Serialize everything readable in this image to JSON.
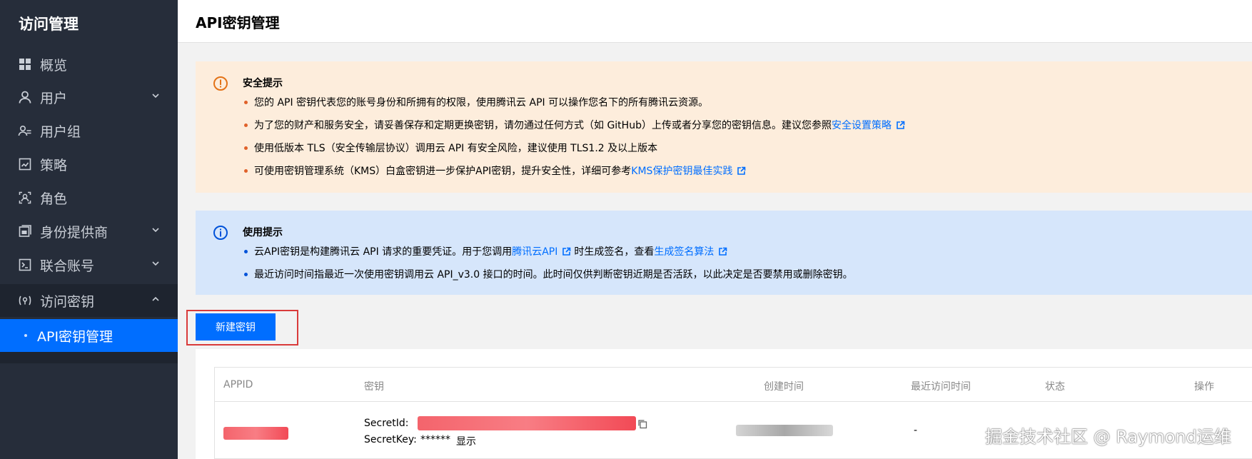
{
  "sidebar": {
    "title": "访问管理",
    "items": [
      {
        "label": "概览",
        "icon": "grid-icon"
      },
      {
        "label": "用户",
        "icon": "user-icon",
        "expandable": true
      },
      {
        "label": "用户组",
        "icon": "user-group-icon"
      },
      {
        "label": "策略",
        "icon": "policy-icon"
      },
      {
        "label": "角色",
        "icon": "role-icon"
      },
      {
        "label": "身份提供商",
        "icon": "identity-provider-icon",
        "expandable": true
      },
      {
        "label": "联合账号",
        "icon": "federated-account-icon",
        "expandable": true
      },
      {
        "label": "访问密钥",
        "icon": "access-key-icon",
        "expandable": true,
        "expanded": true
      }
    ],
    "sub_item": {
      "label": "API密钥管理",
      "active": true
    }
  },
  "header": {
    "title": "API密钥管理"
  },
  "security_notice": {
    "title": "安全提示",
    "lines": [
      "您的 API 密钥代表您的账号身份和所拥有的权限，使用腾讯云 API 可以操作您名下的所有腾讯云资源。",
      "为了您的财产和服务安全，请妥善保存和定期更换密钥，请勿通过任何方式（如 GitHub）上传或者分享您的密钥信息。建议您参照",
      "使用低版本 TLS（安全传输层协议）调用云 API 有安全风险，建议使用 TLS1.2 及以上版本",
      "可使用密钥管理系统（KMS）白盒密钥进一步保护API密钥，提升安全性，详细可参考"
    ],
    "link_1": "安全设置策略",
    "link_2": "KMS保护密钥最佳实践"
  },
  "usage_notice": {
    "title": "使用提示",
    "line1_pre": "云API密钥是构建腾讯云 API 请求的重要凭证。用于您调用",
    "line1_link1": "腾讯云API",
    "line1_mid": "时生成签名，查看",
    "line1_link2": "生成签名算法",
    "line2": "最近访问时间指最近一次使用密钥调用云 API_v3.0 接口的时间。此时间仅供判断密钥近期是否活跃，以此决定是否要禁用或删除密钥。"
  },
  "actions": {
    "new_key_label": "新建密钥"
  },
  "table": {
    "columns": [
      "APPID",
      "密钥",
      "创建时间",
      "最近访问时间",
      "状态",
      "操作"
    ],
    "row": {
      "secret_id_label": "SecretId:",
      "secret_key_label": "SecretKey:",
      "secret_key_masked": "******",
      "show_link": "显示",
      "last_access": "-"
    }
  },
  "watermark": "掘金技术社区 @ Raymond运维",
  "colors": {
    "sidebar_bg": "#262d3a",
    "accent": "#006eff",
    "warn_bg": "#fdeddc",
    "info_bg": "#d6e6fb",
    "highlight_border": "#d93b3b"
  }
}
